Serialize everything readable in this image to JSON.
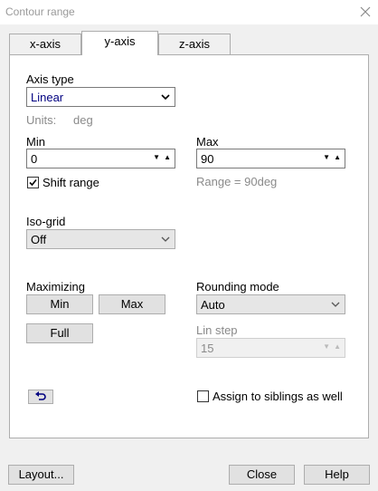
{
  "window": {
    "title": "Contour range"
  },
  "tabs": [
    {
      "label": "x-axis"
    },
    {
      "label": "y-axis"
    },
    {
      "label": "z-axis"
    }
  ],
  "axis_type": {
    "label": "Axis type",
    "value": "Linear"
  },
  "units": {
    "label": "Units:",
    "value": "deg"
  },
  "min": {
    "label": "Min",
    "value": "0"
  },
  "max": {
    "label": "Max",
    "value": "90"
  },
  "shift_range": {
    "label": "Shift range",
    "checked": true
  },
  "range_info": "Range = 90deg",
  "iso_grid": {
    "label": "Iso-grid",
    "value": "Off"
  },
  "maximizing": {
    "label": "Maximizing",
    "min_label": "Min",
    "max_label": "Max",
    "full_label": "Full"
  },
  "rounding_mode": {
    "label": "Rounding mode",
    "value": "Auto"
  },
  "lin_step": {
    "label": "Lin step",
    "value": "15"
  },
  "assign_siblings": {
    "label": "Assign to siblings as well",
    "checked": false
  },
  "footer": {
    "layout_label": "Layout...",
    "close_label": "Close",
    "help_label": "Help"
  },
  "colors": {
    "accent": "#000080",
    "panel": "#ffffff",
    "background": "#f0f0f0"
  }
}
